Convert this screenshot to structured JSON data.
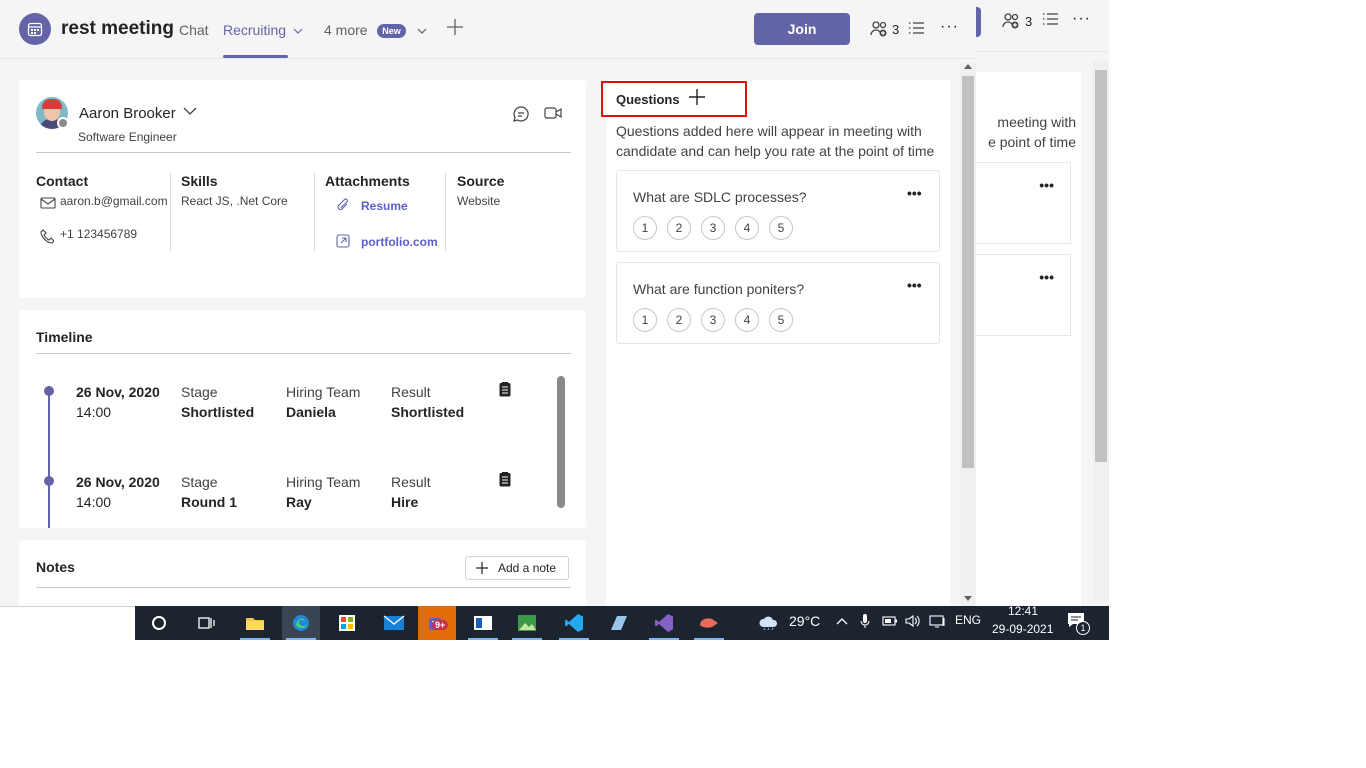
{
  "header": {
    "meeting_title": "rest meeting",
    "tabs": [
      {
        "label": "Chat"
      },
      {
        "label": "Recruiting"
      },
      {
        "label": "4 more"
      }
    ],
    "new_badge": "New",
    "join_label": "Join",
    "participants_count": "3"
  },
  "candidate": {
    "name": "Aaron Brooker",
    "role": "Software Engineer",
    "contact_heading": "Contact",
    "email": "aaron.b@gmail.com",
    "phone": "+1 123456789",
    "skills_heading": "Skills",
    "skills": "React JS, .Net Core",
    "attachments_heading": "Attachments",
    "attachment_resume": "Resume",
    "attachment_portfolio": "portfolio.com",
    "source_heading": "Source",
    "source": "Website"
  },
  "timeline": {
    "title": "Timeline",
    "entries": [
      {
        "date": "26 Nov, 2020",
        "time": "14:00",
        "stage_label": "Stage",
        "stage": "Shortlisted",
        "team_label": "Hiring Team",
        "team": "Daniela",
        "result_label": "Result",
        "result": "Shortlisted"
      },
      {
        "date": "26 Nov, 2020",
        "time": "14:00",
        "stage_label": "Stage",
        "stage": "Round 1",
        "team_label": "Hiring Team",
        "team": "Ray",
        "result_label": "Result",
        "result": "Hire"
      }
    ]
  },
  "notes": {
    "title": "Notes",
    "add_label": "Add a note"
  },
  "questions": {
    "title": "Questions",
    "description": "Questions added here will appear in meeting with candidate and can help you rate at the point of time",
    "items": [
      {
        "text": "What are SDLC processes?",
        "ratings": [
          "1",
          "2",
          "3",
          "4",
          "5"
        ]
      },
      {
        "text": "What are function poniters?",
        "ratings": [
          "1",
          "2",
          "3",
          "4",
          "5"
        ]
      }
    ]
  },
  "background_window": {
    "participants_count": "3",
    "text_line1": "meeting with",
    "text_line2": "e point of time"
  },
  "taskbar": {
    "weather": "29°C",
    "language": "ENG",
    "time": "12:41",
    "date": "29-09-2021",
    "notification_badge": "9+",
    "notification_count": "1"
  },
  "colors": {
    "brand": "#6264a7",
    "highlight": "#e01010",
    "taskbar": "#1c2430"
  }
}
